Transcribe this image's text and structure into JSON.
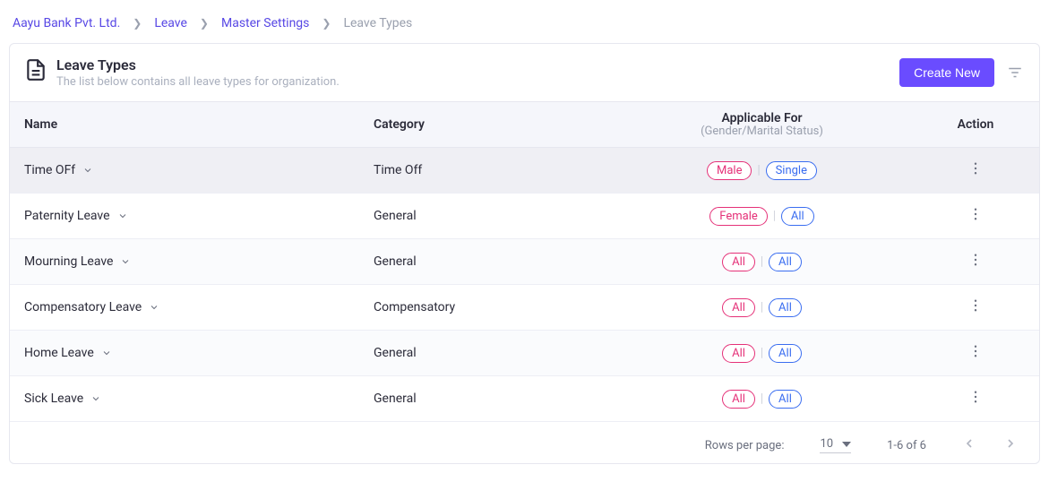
{
  "breadcrumb": {
    "items": [
      "Aayu Bank Pvt. Ltd.",
      "Leave",
      "Master Settings"
    ],
    "current": "Leave Types"
  },
  "header": {
    "title": "Leave Types",
    "subtitle": "The list below contains all leave types for organization.",
    "create_label": "Create New"
  },
  "table": {
    "columns": {
      "name": "Name",
      "category": "Category",
      "applicable": "Applicable For",
      "applicable_sub": "(Gender/Marital Status)",
      "action": "Action"
    },
    "rows": [
      {
        "name": "Time OFf",
        "category": "Time Off",
        "gender": "Male",
        "marital": "Single"
      },
      {
        "name": "Paternity Leave",
        "category": "General",
        "gender": "Female",
        "marital": "All"
      },
      {
        "name": "Mourning Leave",
        "category": "General",
        "gender": "All",
        "marital": "All"
      },
      {
        "name": "Compensatory Leave",
        "category": "Compensatory",
        "gender": "All",
        "marital": "All"
      },
      {
        "name": "Home Leave",
        "category": "General",
        "gender": "All",
        "marital": "All"
      },
      {
        "name": "Sick Leave",
        "category": "General",
        "gender": "All",
        "marital": "All"
      }
    ]
  },
  "pagination": {
    "rows_label": "Rows per page:",
    "rows_value": "10",
    "range": "1-6 of 6"
  }
}
